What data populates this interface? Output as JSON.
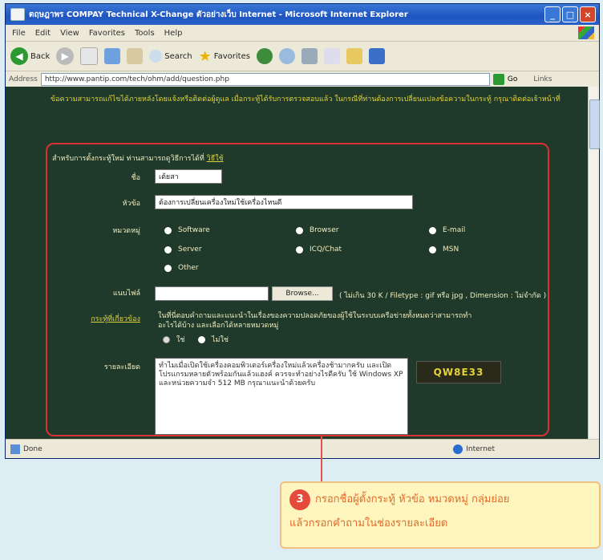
{
  "window": {
    "title": "ตฤษฎาพร COMPAY Technical X-Change ตัวอย่างเว็บ Internet - Microsoft Internet Explorer",
    "menu": [
      "File",
      "Edit",
      "View",
      "Favorites",
      "Tools",
      "Help"
    ],
    "toolbar": {
      "back": "Back",
      "search": "Search",
      "favorites": "Favorites"
    },
    "address_label": "Address",
    "address_url": "http://www.pantip.com/tech/ohm/add/question.php",
    "go_label": "Go",
    "links_label": "Links",
    "status_left": "Done",
    "status_zone": "Internet"
  },
  "page": {
    "top_note": "ข้อความสามารถแก้ไขได้ภายหลังโดยแจ้งหรือติดต่อผู้ดูแล เมื่อกระทู้ได้รับการตรวจสอบแล้ว ในกรณีที่ท่านต้องการเปลี่ยนแปลงข้อความในกระทู้ กรุณาติดต่อเจ้าหน้าที่",
    "info_prefix": "สำหรับการตั้งกระทู้ใหม่ ท่านสามารถดูวิธีการได้ที่",
    "info_link": "วิธีใช้",
    "labels": {
      "name": "ชื่อ",
      "subject": "หัวข้อ",
      "category": "หมวดหมู่",
      "attach": "แนบไฟล์",
      "tags": "กระทู้ที่เกี่ยวข้อง",
      "detail": "รายละเอียด"
    },
    "name_value": "เต้ยสา",
    "subject_value": "ต้องการเปลี่ยนเครื่องใหม่ใช้เครื่องไหนดี",
    "categories": [
      "Software",
      "Browser",
      "E-mail",
      "Server",
      "ICQ/Chat",
      "MSN",
      "Other"
    ],
    "browse_label": "Browse...",
    "attach_note": "( ไม่เกิน 30 K / Filetype : gif หรือ jpg , Dimension : ไม่จำกัด )",
    "tags_text": "ในที่นี่ตอบคำถามและแนะนำในเรื่องของความปลอดภัยของผู้ใช้ในระบบเครือข่ายทั้งหมดว่าสามารถทำอะไรได้บ้าง และเลือกได้หลายหมวดหมู่",
    "yes_label": "ใช่",
    "no_label": "ไม่ใช่",
    "detail_text": "ทำไมเมื่อเปิดใช้เครื่องคอมพิวเตอร์เครื่องใหม่แล้วเครื่องช้ามากครับ และเปิดโปรแกรมหลายตัวพร้อมกันแล้วแฮงค์ ควรจะทำอย่างไรดีครับ ใช้ Windows XP และหน่วยความจำ 512 MB กรุณาแนะนำด้วยครับ",
    "captcha": "QW8E33"
  },
  "callout": {
    "step": "3",
    "line1": "กรอกชื่อผู้ตั้งกระทู้ หัวข้อ หมวดหมู่ กลุ่มย่อย",
    "line2": "แล้วกรอกคำถามในช่องรายละเอียด"
  }
}
